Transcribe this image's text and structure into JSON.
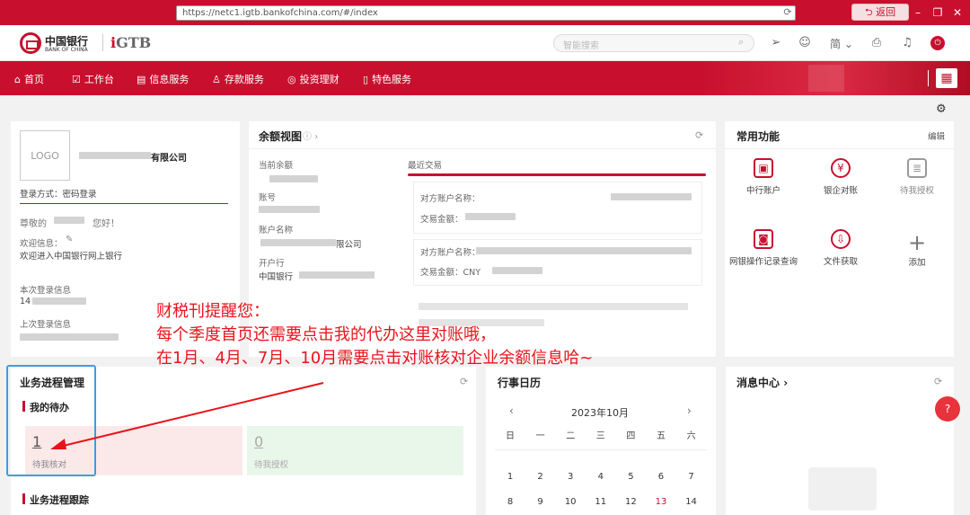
{
  "browser": {
    "url": "https://netc1.igtb.bankofchina.com/#/index",
    "back_label": "返回"
  },
  "header": {
    "brand_cn": "中国银行",
    "brand_en": "BANK OF CHINA",
    "product": "GTB",
    "search_placeholder": "智能搜索",
    "lang": "简"
  },
  "nav": {
    "items": [
      {
        "label": "首页"
      },
      {
        "label": "工作台"
      },
      {
        "label": "信息服务"
      },
      {
        "label": "存款服务"
      },
      {
        "label": "投资理财"
      },
      {
        "label": "特色服务"
      }
    ]
  },
  "user": {
    "logo": "LOGO",
    "company_suffix": "有限公司",
    "login_method": "登录方式：密码登录",
    "greeting_prefix": "尊敬的",
    "greeting_suffix": "您好！",
    "welcome_label": "欢迎信息：",
    "welcome_text": "欢迎进入中国银行网上银行",
    "this_login": "本次登录信息",
    "this_login_val": "14",
    "last_login": "上次登录信息"
  },
  "balance": {
    "title": "余额视图",
    "current_balance": "当前余额",
    "account": "账号",
    "account_name": "账户名称",
    "company_suffix": "限公司",
    "bank": "开户行",
    "bank_val": "中国银行",
    "recent": "最近交易",
    "tx1_name": "对方账户名称：",
    "tx1_amount": "交易金额：",
    "tx2_name": "对方账户名称：",
    "tx2_amount": "交易金额：CNY"
  },
  "common": {
    "title": "常用功能",
    "edit": "编辑",
    "items": [
      {
        "label": "中行账户"
      },
      {
        "label": "银企对账"
      },
      {
        "label": "待我授权"
      },
      {
        "label": "网银操作记录查询"
      },
      {
        "label": "文件获取"
      },
      {
        "label": "添加"
      }
    ]
  },
  "business": {
    "title": "业务进程管理",
    "todo_title": "我的待办",
    "todo_count": "1",
    "todo_label": "待我核对",
    "auth_count": "0",
    "auth_label": "待我授权",
    "track_title": "业务进程跟踪"
  },
  "calendar": {
    "title": "行事日历",
    "month": "2023年10月",
    "weekdays": [
      "日",
      "一",
      "二",
      "三",
      "四",
      "五",
      "六"
    ],
    "row1": [
      "1",
      "2",
      "3",
      "4",
      "5",
      "6",
      "7"
    ],
    "row2": [
      "8",
      "9",
      "10",
      "11",
      "12",
      "13",
      "14"
    ],
    "today": "13"
  },
  "messages": {
    "title": "消息中心"
  },
  "annotation": {
    "line1": "财税刊提醒您：",
    "line2": "每个季度首页还需要点击我的代办这里对账哦，",
    "line3": "在1月、4月、7月、10月需要点击对账核对企业余额信息哈~"
  },
  "help": "?",
  "colors": {
    "brand": "#c8102e",
    "annotation": "#e8141c",
    "highlight": "#3a9fe0"
  }
}
